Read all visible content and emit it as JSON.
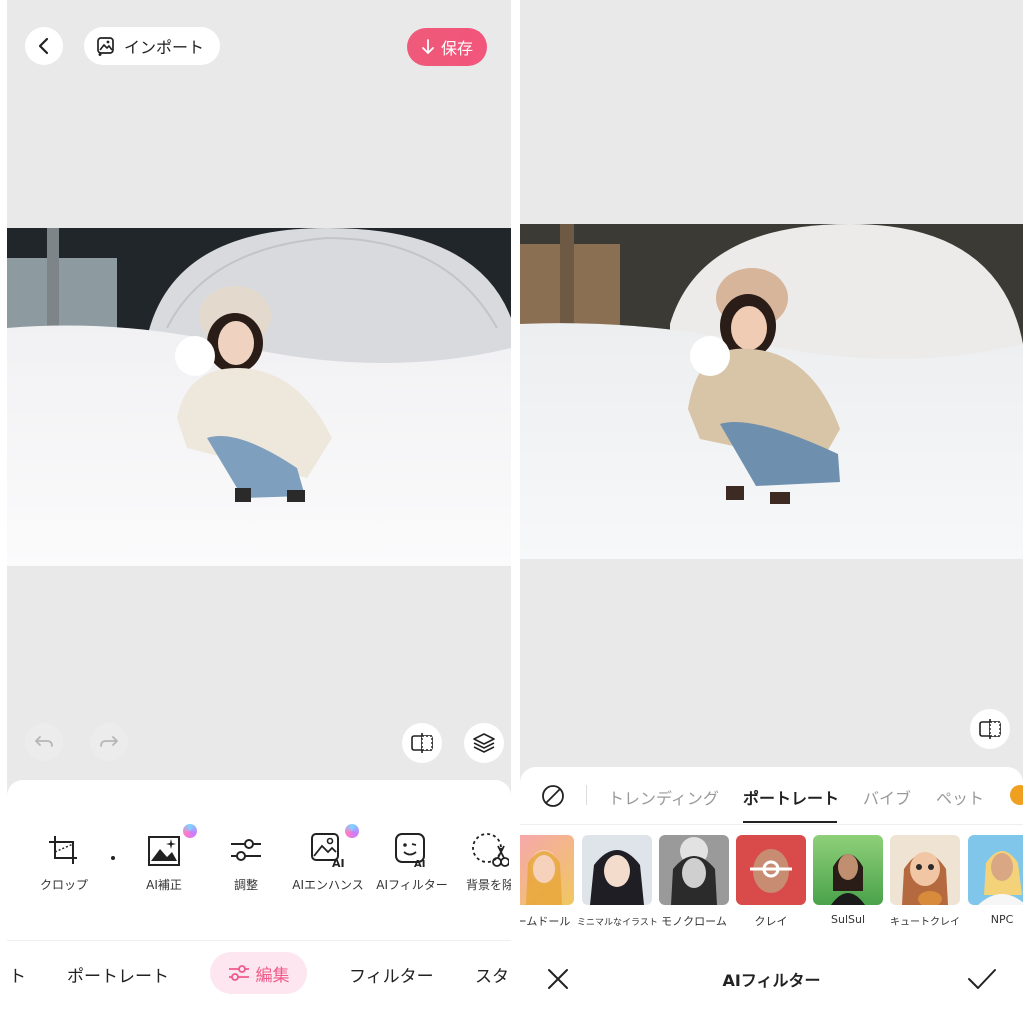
{
  "left": {
    "top_bar": {
      "import_label": "インポート",
      "save_label": "保存"
    },
    "tools": [
      {
        "label": "クロップ",
        "icon": "crop-icon"
      },
      {
        "label": "AI補正",
        "icon": "image-sparkle-icon",
        "badge": true
      },
      {
        "label": "調整",
        "icon": "sliders-icon"
      },
      {
        "label": "AIエンハンス",
        "icon": "image-ai-icon",
        "badge": true
      },
      {
        "label": "AIフィルター",
        "icon": "face-ai-icon"
      },
      {
        "label": "背景を除",
        "icon": "cut-background-icon",
        "badge": true
      }
    ],
    "bottom_tabs": [
      "ト",
      "ポートレート",
      "編集",
      "フィルター",
      "スタ"
    ],
    "active_tab": "編集"
  },
  "right": {
    "categories": [
      "トレンディング",
      "ポートレート",
      "バイブ",
      "ペット"
    ],
    "active_category": "ポートレート",
    "filters": [
      "ームドール",
      "ミニマルなイラスト",
      "モノクローム",
      "クレイ",
      "SulSul",
      "キュートクレイ",
      "NPC"
    ],
    "footer_title": "AIフィルター"
  },
  "colors": {
    "accent": "#ef5a7a",
    "active_tab_bg": "#fde6ef",
    "canvas_bg": "#e9e9e9"
  }
}
